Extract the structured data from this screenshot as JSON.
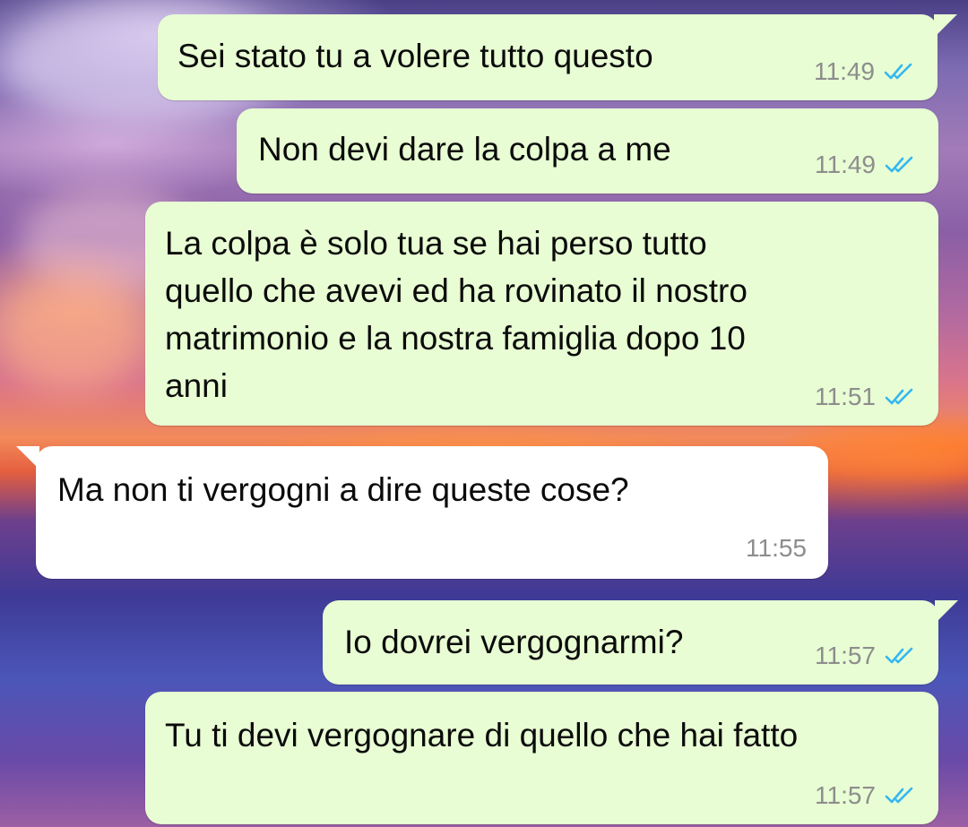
{
  "chat": {
    "messages": [
      {
        "direction": "outgoing",
        "text": "Sei stato tu a volere tutto questo",
        "time": "11:49",
        "status": "read",
        "ticks_icon": "double-check-icon"
      },
      {
        "direction": "outgoing",
        "text": "Non devi dare la colpa a me",
        "time": "11:49",
        "status": "read",
        "ticks_icon": "double-check-icon"
      },
      {
        "direction": "outgoing",
        "lines": [
          "La colpa è solo tua se hai perso tutto",
          "quello che avevi ed ha rovinato il nostro",
          "matrimonio e la nostra famiglia dopo 10",
          "anni"
        ],
        "time": "11:51",
        "status": "read",
        "ticks_icon": "double-check-icon"
      },
      {
        "direction": "incoming",
        "text": "Ma non ti vergogni a dire queste cose?",
        "time": "11:55"
      },
      {
        "direction": "outgoing",
        "text": "Io dovrei vergognarmi?",
        "time": "11:57",
        "status": "read",
        "ticks_icon": "double-check-icon"
      },
      {
        "direction": "outgoing",
        "text": "Tu ti devi vergognare di quello che hai fatto",
        "time": "11:57",
        "status": "read",
        "ticks_icon": "double-check-icon"
      }
    ]
  },
  "colors": {
    "outgoing_bubble": "#e8fdd3",
    "incoming_bubble": "#ffffff",
    "read_ticks": "#34b7f1",
    "timestamp": "#8d8d8d",
    "message_text": "#0b0b0b"
  }
}
